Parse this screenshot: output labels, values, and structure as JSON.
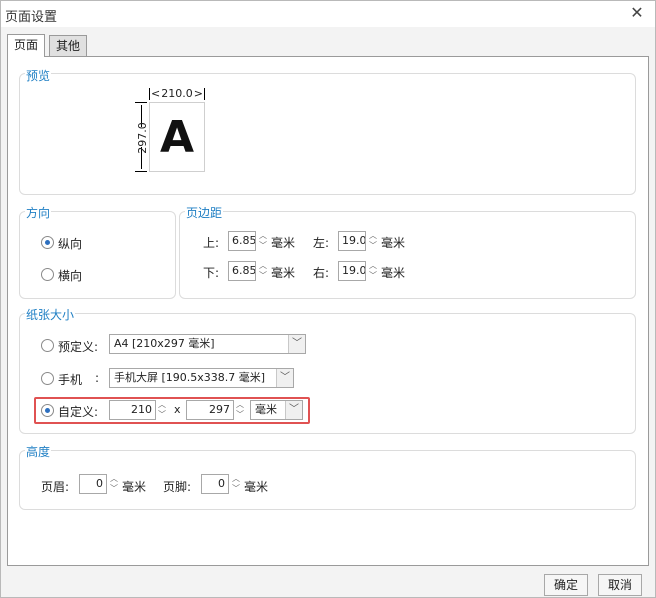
{
  "window": {
    "title": "页面设置",
    "close_glyph": "✕"
  },
  "tabs": [
    {
      "label": "页面"
    },
    {
      "label": "其他"
    }
  ],
  "preview": {
    "title": "预览",
    "width_label": "210.0",
    "height_label": "297.0",
    "letter": "A"
  },
  "orientation": {
    "title": "方向",
    "options": [
      {
        "label": "纵向",
        "checked": true
      },
      {
        "label": "横向",
        "checked": false
      }
    ]
  },
  "margins": {
    "title": "页边距",
    "top_label": "上:",
    "top_value": "6.85",
    "left_label": "左:",
    "left_value": "19.05",
    "bottom_label": "下:",
    "bottom_value": "6.85",
    "right_label": "右:",
    "right_value": "19.05",
    "unit": "毫米"
  },
  "paper": {
    "title": "纸张大小",
    "predefined_label": "预定义:",
    "predefined_value": "A4 [210x297 毫米]",
    "phone_label": "手机",
    "phone_colon": ":",
    "phone_value": "手机大屏 [190.5x338.7 毫米]",
    "custom_label": "自定义:",
    "custom_width": "210",
    "custom_x": "x",
    "custom_height": "297",
    "custom_unit": "毫米"
  },
  "height": {
    "title": "高度",
    "header_label": "页眉:",
    "header_value": "0",
    "footer_label": "页脚:",
    "footer_value": "0",
    "unit": "毫米"
  },
  "buttons": {
    "ok": "确定",
    "cancel": "取消"
  }
}
